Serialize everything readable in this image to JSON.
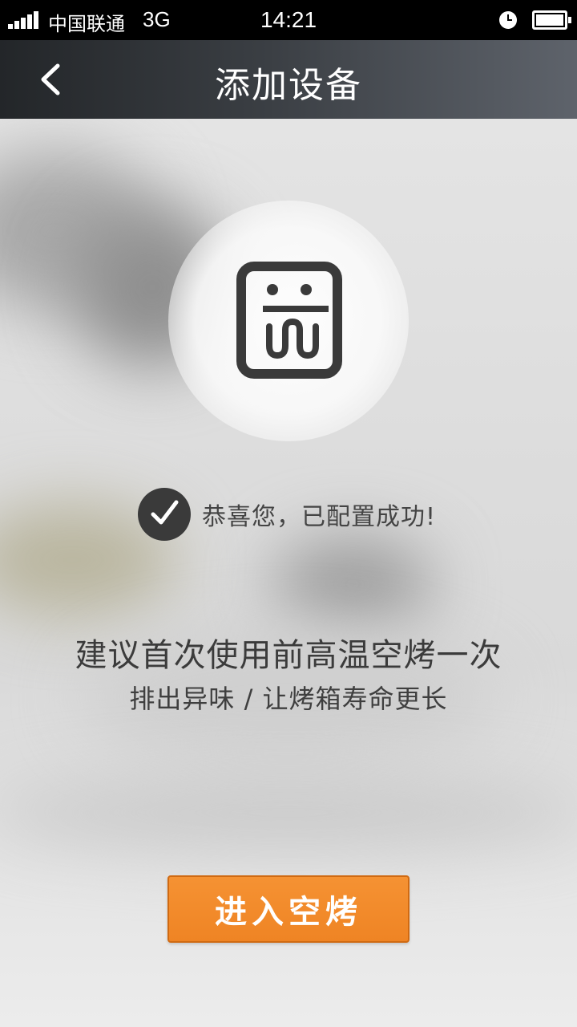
{
  "status_bar": {
    "carrier": "中国联通",
    "network": "3G",
    "time": "14:21",
    "icons": [
      "signal-icon",
      "clock-icon",
      "battery-icon"
    ]
  },
  "header": {
    "back_icon": "chevron-left-icon",
    "title": "添加设备"
  },
  "device": {
    "icon": "oven-icon"
  },
  "status": {
    "icon": "check-circle-icon",
    "message": "恭喜您，已配置成功!"
  },
  "tips": {
    "main": "建议首次使用前高温空烤一次",
    "sub": "排出异味 / 让烤箱寿命更长"
  },
  "actions": {
    "enter_label": "进入空烤"
  },
  "colors": {
    "accent": "#f08a2a",
    "header_bg": "#2b2e32",
    "status_bar_bg": "#000000",
    "icon_dark": "#3a3a3a"
  }
}
